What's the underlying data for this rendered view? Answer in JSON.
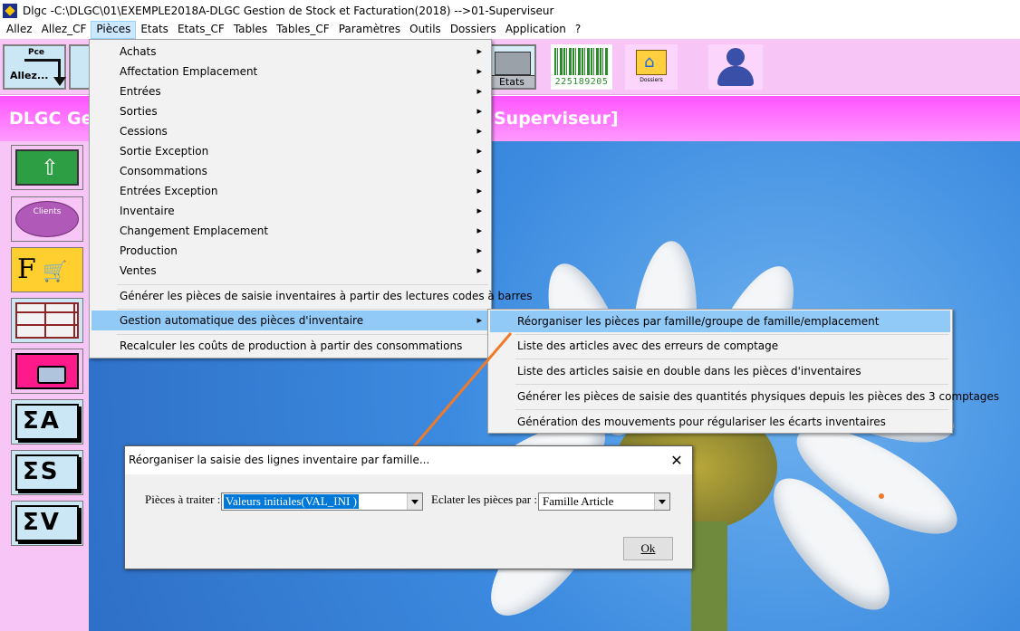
{
  "window": {
    "title": "Dlgc -C:\\DLGC\\01\\EXEMPLE2018A-DLGC Gestion de Stock et Facturation(2018) -->01-Superviseur"
  },
  "menubar": {
    "items": [
      "Allez",
      "Allez_CF",
      "Pièces",
      "Etats",
      "Etats_CF",
      "Tables",
      "Tables_CF",
      "Paramètres",
      "Outils",
      "Dossiers",
      "Application",
      "?"
    ],
    "active": "Pièces"
  },
  "toolbar": {
    "allez_top": "Pce",
    "allez_label": "Allez...",
    "etats_label": "Etats",
    "barcode_number": "225189205",
    "dossiers_label": "Dossiers"
  },
  "banner": {
    "text_left": "DLGC Ge",
    "text_right": "Superviseur]"
  },
  "sidebar": {
    "clients_label": "Clients",
    "sigma_a": "ΣA",
    "sigma_s": "ΣS",
    "sigma_v": "ΣV"
  },
  "pieces_menu": {
    "items": [
      "Achats",
      "Affectation Emplacement",
      "Entrées",
      "Sorties",
      "Cessions",
      "Sortie Exception",
      "Consommations",
      "Entrées Exception",
      "Inventaire",
      "Changement Emplacement",
      "Production",
      "Ventes"
    ],
    "generer": "Générer les pièces de saisie inventaires à partir des lectures codes à barres",
    "gestion_auto": "Gestion automatique des pièces d'inventaire",
    "recalculer": "Recalculer les coûts de production à partir des consommations"
  },
  "submenu": {
    "items": [
      "Réorganiser les pièces par famille/groupe de famille/emplacement",
      "Liste des articles avec des erreurs de comptage",
      "Liste des articles saisie en double dans les pièces d'inventaires",
      "Générer les pièces de saisie des quantités physiques depuis les pièces des 3 comptages",
      "Génération des mouvements pour régulariser les écarts inventaires"
    ]
  },
  "dialog": {
    "title": "Réorganiser la saisie des lignes inventaire par famille...",
    "pieces_label": "Pièces à traiter :",
    "pieces_value": "Valeurs initiales(VAL_INI  )",
    "eclater_label": "Eclater les pièces par :",
    "eclater_value": "Famille Article",
    "ok_label": "Ok",
    "close_glyph": "✕"
  },
  "colors": {
    "pink": "#f7c6f6",
    "banner": "#ff55ff",
    "highlight": "#91c9f7",
    "annotation": "#f07a2a"
  }
}
